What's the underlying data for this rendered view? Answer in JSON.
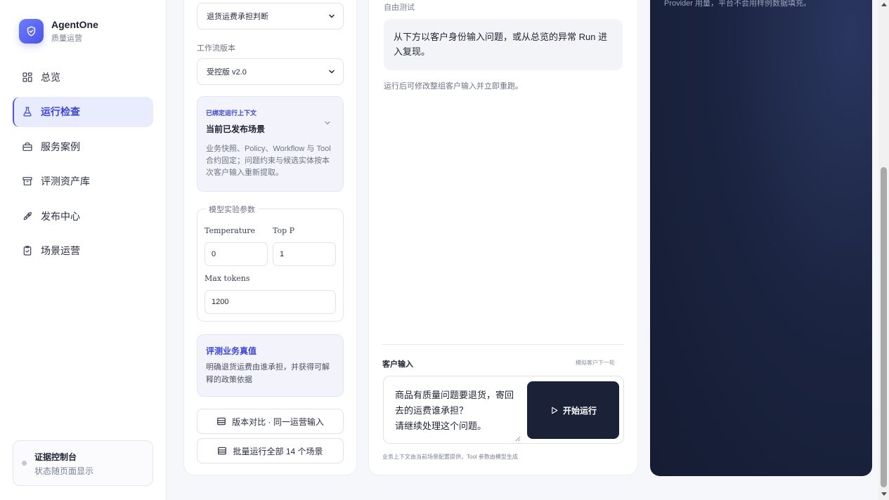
{
  "brand": {
    "title": "AgentOne",
    "subtitle": "质量运营"
  },
  "sidebar": {
    "items": [
      {
        "label": "总览",
        "icon": "grid-icon"
      },
      {
        "label": "运行检查",
        "icon": "flask-icon",
        "active": true
      },
      {
        "label": "服务案例",
        "icon": "briefcase-icon"
      },
      {
        "label": "评测资产库",
        "icon": "archive-icon"
      },
      {
        "label": "发布中心",
        "icon": "rocket-icon"
      },
      {
        "label": "场景运营",
        "icon": "clipboard-check-icon"
      }
    ],
    "evidence": {
      "title": "证据控制台",
      "subtitle": "状态随页面显示"
    }
  },
  "config": {
    "scenario_select": "退货运费承担判断",
    "workflow_label": "工作流版本",
    "workflow_select": "受控版 v2.0",
    "context": {
      "tag": "已绑定运行上下文",
      "title": "当前已发布场景",
      "desc": "业务快照、Policy、Workflow 与 Tool 合约固定；问题约束与候选实体按本次客户输入重新提取。"
    },
    "model": {
      "legend": "模型实验参数",
      "temperature_label": "Temperature",
      "temperature_value": "0",
      "top_p_label": "Top P",
      "top_p_value": "1",
      "max_tokens_label": "Max tokens",
      "max_tokens_value": "1200"
    },
    "truth": {
      "title": "评测业务真值",
      "desc": "明确退货运费由谁承担，并获得可解释的政策依据"
    },
    "compare_button": "版本对比 · 同一运营输入",
    "batch_button": "批量运行全部 14 个场景"
  },
  "chat": {
    "free_test_label": "自由测试",
    "assistant_message": "从下方以客户身份输入问题，或从总览的异常 Run 进入复现。",
    "hint": "运行后可修改整组客户输入并立即重跑。",
    "customer_input_label": "客户输入",
    "customer_input_hint": "模拟客户下一轮",
    "customer_input_value": "商品有质量问题要退货，寄回去的运费谁承担？\n请继续处理这个问题。",
    "run_button": "开始运行",
    "footer_note": "业务上下文由当前场景配置提供，Tool 参数由模型生成"
  },
  "dark_panel": {
    "text": "Provider 用量，平台不会用样例数据填充。"
  },
  "colors": {
    "accent": "#4b55e6",
    "dark": "#1b2136",
    "active_bg": "#e9ebff"
  }
}
